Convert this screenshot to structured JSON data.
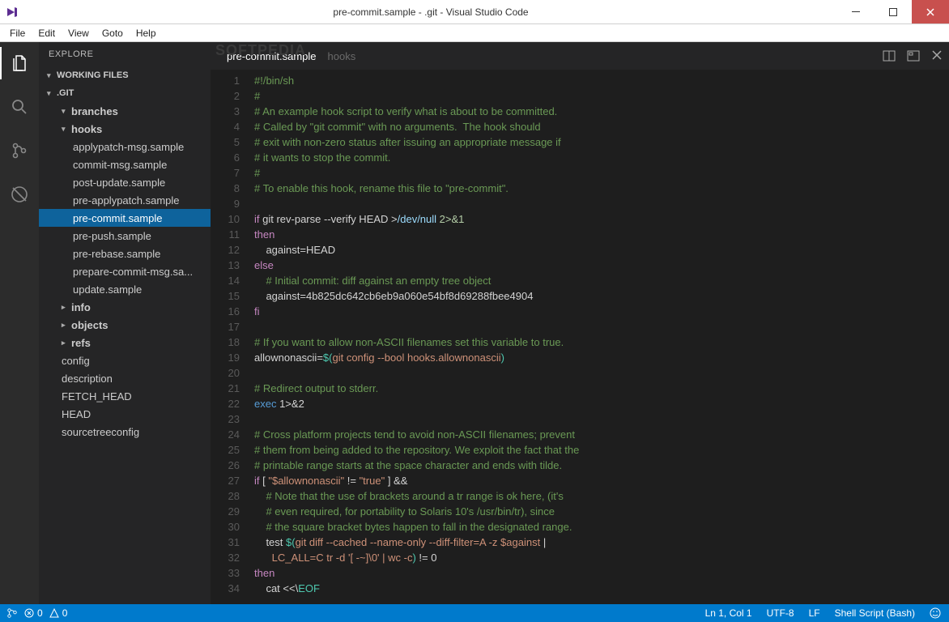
{
  "window": {
    "title": "pre-commit.sample - .git - Visual Studio Code"
  },
  "menubar": [
    "File",
    "Edit",
    "View",
    "Goto",
    "Help"
  ],
  "activitybar": {
    "items": [
      {
        "name": "explorer-icon",
        "active": true
      },
      {
        "name": "search-icon",
        "active": false
      },
      {
        "name": "git-icon",
        "active": false
      },
      {
        "name": "debug-icon",
        "active": false
      }
    ]
  },
  "sidebar": {
    "title": "EXPLORE",
    "working_files_label": "WORKING FILES",
    "root_label": ".GIT",
    "tree": [
      {
        "label": "branches",
        "indent": 1,
        "arrow": "▾",
        "bold": true
      },
      {
        "label": "hooks",
        "indent": 1,
        "arrow": "▾",
        "bold": true
      },
      {
        "label": "applypatch-msg.sample",
        "indent": 2
      },
      {
        "label": "commit-msg.sample",
        "indent": 2
      },
      {
        "label": "post-update.sample",
        "indent": 2
      },
      {
        "label": "pre-applypatch.sample",
        "indent": 2
      },
      {
        "label": "pre-commit.sample",
        "indent": 2,
        "selected": true
      },
      {
        "label": "pre-push.sample",
        "indent": 2
      },
      {
        "label": "pre-rebase.sample",
        "indent": 2
      },
      {
        "label": "prepare-commit-msg.sa...",
        "indent": 2
      },
      {
        "label": "update.sample",
        "indent": 2
      },
      {
        "label": "info",
        "indent": 1,
        "arrow": "▸",
        "bold": true
      },
      {
        "label": "objects",
        "indent": 1,
        "arrow": "▸",
        "bold": true
      },
      {
        "label": "refs",
        "indent": 1,
        "arrow": "▸",
        "bold": true
      },
      {
        "label": "config",
        "indent": 1
      },
      {
        "label": "description",
        "indent": 1
      },
      {
        "label": "FETCH_HEAD",
        "indent": 1
      },
      {
        "label": "HEAD",
        "indent": 1
      },
      {
        "label": "sourcetreeconfig",
        "indent": 1
      }
    ]
  },
  "editor": {
    "tab_name": "pre-commit.sample",
    "tab_folder": "hooks",
    "watermark": "SOFTPEDIA",
    "lines": [
      [
        {
          "t": "#!/bin/sh",
          "c": "comment"
        }
      ],
      [
        {
          "t": "#",
          "c": "comment"
        }
      ],
      [
        {
          "t": "# An example hook script to verify what is about to be committed.",
          "c": "comment"
        }
      ],
      [
        {
          "t": "# Called by \"git commit\" with no arguments.  The hook should",
          "c": "comment"
        }
      ],
      [
        {
          "t": "# exit with non-zero status after issuing an appropriate message if",
          "c": "comment"
        }
      ],
      [
        {
          "t": "# it wants to stop the commit.",
          "c": "comment"
        }
      ],
      [
        {
          "t": "#",
          "c": "comment"
        }
      ],
      [
        {
          "t": "# To enable this hook, rename this file to \"pre-commit\".",
          "c": "comment"
        }
      ],
      [
        {
          "t": "",
          "c": ""
        }
      ],
      [
        {
          "t": "if",
          "c": "keyword"
        },
        {
          "t": " git rev-parse --verify HEAD >",
          "c": "var"
        },
        {
          "t": "/dev/null",
          "c": "cyan"
        },
        {
          "t": " 2>&1",
          "c": "number"
        }
      ],
      [
        {
          "t": "then",
          "c": "keyword"
        }
      ],
      [
        {
          "t": "    against=HEAD",
          "c": "var"
        }
      ],
      [
        {
          "t": "else",
          "c": "keyword"
        }
      ],
      [
        {
          "t": "    # Initial commit: diff against an empty tree object",
          "c": "comment"
        }
      ],
      [
        {
          "t": "    against=4b825dc642cb6eb9a060e54bf8d69288fbee4904",
          "c": "var"
        }
      ],
      [
        {
          "t": "fi",
          "c": "keyword"
        }
      ],
      [
        {
          "t": "",
          "c": ""
        }
      ],
      [
        {
          "t": "# If you want to allow non-ASCII filenames set this variable to true.",
          "c": "comment"
        }
      ],
      [
        {
          "t": "allownonascii=",
          "c": "var"
        },
        {
          "t": "$(",
          "c": "special"
        },
        {
          "t": "git config --bool hooks.allownonascii",
          "c": "string"
        },
        {
          "t": ")",
          "c": "special"
        }
      ],
      [
        {
          "t": "",
          "c": ""
        }
      ],
      [
        {
          "t": "# Redirect output to stderr.",
          "c": "comment"
        }
      ],
      [
        {
          "t": "exec",
          "c": "builtin"
        },
        {
          "t": " 1>&2",
          "c": "var"
        }
      ],
      [
        {
          "t": "",
          "c": ""
        }
      ],
      [
        {
          "t": "# Cross platform projects tend to avoid non-ASCII filenames; prevent",
          "c": "comment"
        }
      ],
      [
        {
          "t": "# them from being added to the repository. We exploit the fact that the",
          "c": "comment"
        }
      ],
      [
        {
          "t": "# printable range starts at the space character and ends with tilde.",
          "c": "comment"
        }
      ],
      [
        {
          "t": "if",
          "c": "keyword"
        },
        {
          "t": " [ ",
          "c": "var"
        },
        {
          "t": "\"$allownonascii\"",
          "c": "string"
        },
        {
          "t": " != ",
          "c": "var"
        },
        {
          "t": "\"true\"",
          "c": "string"
        },
        {
          "t": " ] &&",
          "c": "var"
        }
      ],
      [
        {
          "t": "    # Note that the use of brackets around a tr range is ok here, (it's",
          "c": "comment"
        }
      ],
      [
        {
          "t": "    # even required, for portability to Solaris 10's /usr/bin/tr), since",
          "c": "comment"
        }
      ],
      [
        {
          "t": "    # the square bracket bytes happen to fall in the designated range.",
          "c": "comment"
        }
      ],
      [
        {
          "t": "    test ",
          "c": "var"
        },
        {
          "t": "$(",
          "c": "special"
        },
        {
          "t": "git diff --cached --name-only --diff-filter=A -z $against",
          "c": "string"
        },
        {
          "t": " |",
          "c": "var"
        }
      ],
      [
        {
          "t": "      LC_ALL=C tr -d ",
          "c": "string"
        },
        {
          "t": "'[ -~]\\0'",
          "c": "string"
        },
        {
          "t": " | wc -c",
          "c": "string"
        },
        {
          "t": ")",
          "c": "special"
        },
        {
          "t": " != 0",
          "c": "var"
        }
      ],
      [
        {
          "t": "then",
          "c": "keyword"
        }
      ],
      [
        {
          "t": "    cat ",
          "c": "var"
        },
        {
          "t": "<<\\",
          "c": "var"
        },
        {
          "t": "EOF",
          "c": "special"
        }
      ]
    ]
  },
  "statusbar": {
    "git_branch_icon": "⎇",
    "errors": "0",
    "warnings": "0",
    "position": "Ln 1, Col 1",
    "encoding": "UTF-8",
    "eol": "LF",
    "language": "Shell Script (Bash)"
  }
}
